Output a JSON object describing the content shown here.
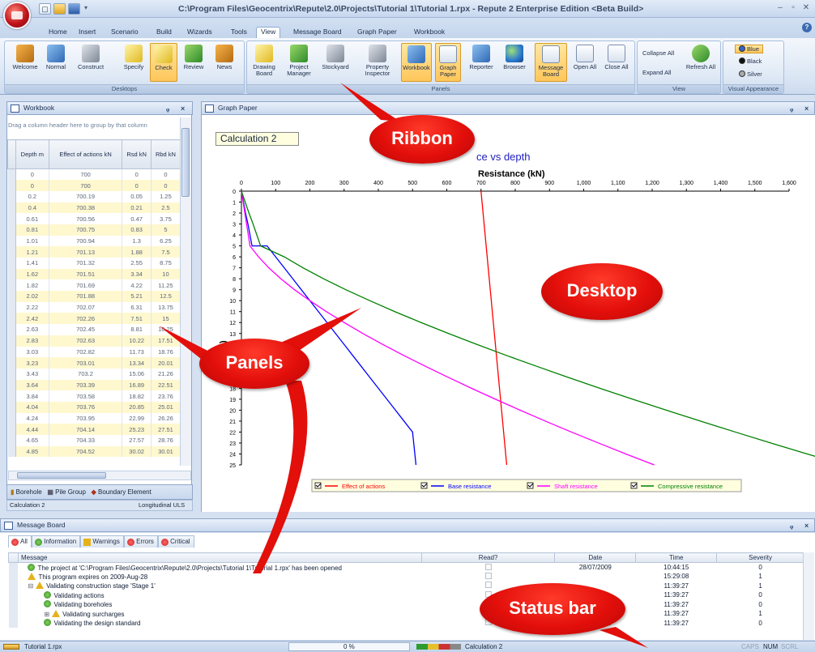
{
  "window": {
    "title": "C:\\Program Files\\Geocentrix\\Repute\\2.0\\Projects\\Tutorial 1\\Tutorial 1.rpx - Repute 2 Enterprise Edition <Beta Build>",
    "min": "–",
    "max": "▫",
    "close": "✕"
  },
  "ribbon_tabs": [
    "Home",
    "Insert",
    "Scenario",
    "Build",
    "Wizards",
    "Tools",
    "View",
    "Message Board",
    "Graph Paper",
    "Workbook"
  ],
  "ribbon_groups": {
    "desktops": {
      "label": "Desktops",
      "buttons": [
        "Welcome",
        "Normal",
        "Construct",
        "Specify",
        "Check",
        "Review",
        "News"
      ]
    },
    "panels": {
      "label": "Panels",
      "buttons": [
        "Drawing Board",
        "Project Manager",
        "Stockyard",
        "Property Inspector",
        "Workbook",
        "Graph Paper",
        "Reporter",
        "Browser",
        "Message Board",
        "Open All",
        "Close All"
      ]
    },
    "view": {
      "label": "View",
      "buttons": [
        "Collapse All",
        "Expand All",
        "Refresh All"
      ]
    },
    "visual": {
      "label": "Visual Appearance",
      "options": [
        "Blue",
        "Black",
        "Silver"
      ]
    }
  },
  "workbook": {
    "title": "Workbook",
    "drag_hint": "Drag a column header here to group by that column",
    "columns": [
      "Depth m",
      "Effect of actions kN",
      "Rsd kN",
      "Rbd kN"
    ],
    "rows": [
      [
        "0",
        "700",
        "0",
        "0"
      ],
      [
        "0",
        "700",
        "0",
        "0"
      ],
      [
        "0.2",
        "700.19",
        "0.05",
        "1.25"
      ],
      [
        "0.4",
        "700.38",
        "0.21",
        "2.5"
      ],
      [
        "0.61",
        "700.56",
        "0.47",
        "3.75"
      ],
      [
        "0.81",
        "700.75",
        "0.83",
        "5"
      ],
      [
        "1.01",
        "700.94",
        "1.3",
        "6.25"
      ],
      [
        "1.21",
        "701.13",
        "1.88",
        "7.5"
      ],
      [
        "1.41",
        "701.32",
        "2.55",
        "8.75"
      ],
      [
        "1.62",
        "701.51",
        "3.34",
        "10"
      ],
      [
        "1.82",
        "701.69",
        "4.22",
        "11.25"
      ],
      [
        "2.02",
        "701.88",
        "5.21",
        "12.5"
      ],
      [
        "2.22",
        "702.07",
        "6.31",
        "13.75"
      ],
      [
        "2.42",
        "702.26",
        "7.51",
        "15"
      ],
      [
        "2.63",
        "702.45",
        "8.81",
        "16.25"
      ],
      [
        "2.83",
        "702.63",
        "10.22",
        "17.51"
      ],
      [
        "3.03",
        "702.82",
        "11.73",
        "18.76"
      ],
      [
        "3.23",
        "703.01",
        "13.34",
        "20.01"
      ],
      [
        "3.43",
        "703.2",
        "15.06",
        "21.26"
      ],
      [
        "3.64",
        "703.39",
        "16.89",
        "22.51"
      ],
      [
        "3.84",
        "703.58",
        "18.82",
        "23.76"
      ],
      [
        "4.04",
        "703.76",
        "20.85",
        "25.01"
      ],
      [
        "4.24",
        "703.95",
        "22.99",
        "26.26"
      ],
      [
        "4.44",
        "704.14",
        "25.23",
        "27.51"
      ],
      [
        "4.65",
        "704.33",
        "27.57",
        "28.76"
      ],
      [
        "4.85",
        "704.52",
        "30.02",
        "30.01"
      ]
    ],
    "bottom_tabs": [
      "Borehole",
      "Pile Group",
      "Boundary Element"
    ],
    "status_left": "Calculation 2",
    "status_right": "Longitudinal ULS"
  },
  "graph_paper": {
    "title": "Graph Paper",
    "calc_label": "Calculation 2"
  },
  "chart_data": {
    "type": "line",
    "title": "ce vs depth",
    "xlabel": "Resistance (kN)",
    "ylabel": "epth (m)",
    "xlim": [
      0,
      1600
    ],
    "ylim": [
      0,
      25
    ],
    "xticks": [
      "0",
      "100",
      "200",
      "300",
      "400",
      "500",
      "600",
      "700",
      "800",
      "900",
      "1,000",
      "1,100",
      "1,200",
      "1,300",
      "1,400",
      "1,500",
      "1,600"
    ],
    "yticks": [
      "0",
      "1",
      "2",
      "3",
      "4",
      "5",
      "6",
      "7",
      "8",
      "9",
      "10",
      "11",
      "12",
      "13",
      "14",
      "15",
      "16",
      "17",
      "18",
      "19",
      "20",
      "21",
      "22",
      "23",
      "24",
      "25"
    ],
    "grid": false,
    "legend_position": "bottom",
    "series": [
      {
        "name": "Effect of actions",
        "color": "#ff0000",
        "x": [
          700,
          703,
          706,
          709,
          712,
          715,
          718,
          721,
          724,
          727,
          730,
          733,
          736,
          739,
          742,
          745,
          748,
          751,
          754,
          757,
          760,
          763,
          766,
          769,
          772,
          775
        ],
        "y": [
          0,
          1,
          2,
          3,
          4,
          5,
          6,
          7,
          8,
          9,
          10,
          11,
          12,
          13,
          14,
          15,
          16,
          17,
          18,
          19,
          20,
          21,
          22,
          23,
          24,
          25
        ]
      },
      {
        "name": "Base resistance",
        "color": "#0000ff",
        "x": [
          0,
          6,
          12,
          19,
          25,
          31,
          75,
          100,
          125,
          150,
          175,
          200,
          225,
          250,
          275,
          300,
          325,
          350,
          375,
          400,
          425,
          450,
          475,
          500,
          510
        ],
        "y": [
          0,
          1,
          2,
          3,
          4,
          5,
          5,
          6,
          7,
          8,
          9,
          10,
          11,
          12,
          13,
          14,
          15,
          16,
          17,
          18,
          19,
          20,
          21,
          22,
          25
        ]
      },
      {
        "name": "Shaft resistance",
        "color": "#ff00ff",
        "x": [
          0,
          5,
          10,
          15,
          20,
          25,
          50,
          80,
          115,
          155,
          200,
          248,
          300,
          355,
          413,
          474,
          538,
          604,
          672,
          742,
          814,
          888,
          964,
          1043,
          1123,
          1206
        ],
        "y": [
          0,
          1,
          2,
          3,
          4,
          5,
          6,
          7,
          8,
          9,
          10,
          11,
          12,
          13,
          14,
          15,
          16,
          17,
          18,
          19,
          20,
          21,
          22,
          23,
          24,
          25
        ]
      },
      {
        "name": "Compressive resistance",
        "color": "#008000",
        "x": [
          0,
          11,
          22,
          34,
          45,
          56,
          125,
          180,
          240,
          305,
          375,
          448,
          525,
          605,
          688,
          774,
          863,
          954,
          1047,
          1143,
          1241,
          1341,
          1443,
          1547,
          1653,
          1760
        ],
        "y": [
          0,
          1,
          2,
          3,
          4,
          5,
          6,
          7,
          8,
          9,
          10,
          11,
          12,
          13,
          14,
          15,
          16,
          17,
          18,
          19,
          20,
          21,
          22,
          23,
          24,
          25
        ]
      }
    ]
  },
  "message_board": {
    "title": "Message Board",
    "tabs": [
      "All",
      "Information",
      "Warnings",
      "Errors",
      "Critical"
    ],
    "columns": [
      "Message",
      "Read?",
      "Date",
      "Time",
      "Severity"
    ],
    "rows": [
      {
        "icon": "info",
        "indent": 0,
        "message": "The project at 'C:\\Program Files\\Geocentrix\\Repute\\2.0\\Projects\\Tutorial 1\\Tutorial 1.rpx' has been opened",
        "date": "28/07/2009",
        "time": "10:44:15",
        "severity": "0"
      },
      {
        "icon": "warning",
        "indent": 0,
        "message": "This program expires on 2009-Aug-28",
        "date": "",
        "time": "15:29:08",
        "severity": "1"
      },
      {
        "icon": "warning",
        "indent": 0,
        "expander": "⊟",
        "message": "Validating construction stage 'Stage 1'",
        "date": "",
        "time": "11:39:27",
        "severity": "1"
      },
      {
        "icon": "info",
        "indent": 1,
        "message": "Validating actions",
        "date": "",
        "time": "11:39:27",
        "severity": "0"
      },
      {
        "icon": "info",
        "indent": 1,
        "message": "Validating boreholes",
        "date": "",
        "time": "11:39:27",
        "severity": "0"
      },
      {
        "icon": "warning",
        "indent": 1,
        "expander": "⊞",
        "message": "Validating surcharges",
        "date": "28/07/2009",
        "time": "11:39:27",
        "severity": "1"
      },
      {
        "icon": "info",
        "indent": 1,
        "message": "Validating the design standard",
        "date": "28/07/2009",
        "time": "11:39:27",
        "severity": "0"
      }
    ]
  },
  "status_bar": {
    "file": "Tutorial 1.rpx",
    "progress": "0 %",
    "calc": "Calculation 2",
    "caps": "CAPS",
    "num": "NUM",
    "scrl": "SCRL"
  },
  "callouts": {
    "ribbon": "Ribbon",
    "desktop": "Desktop",
    "panels": "Panels",
    "status": "Status bar"
  }
}
